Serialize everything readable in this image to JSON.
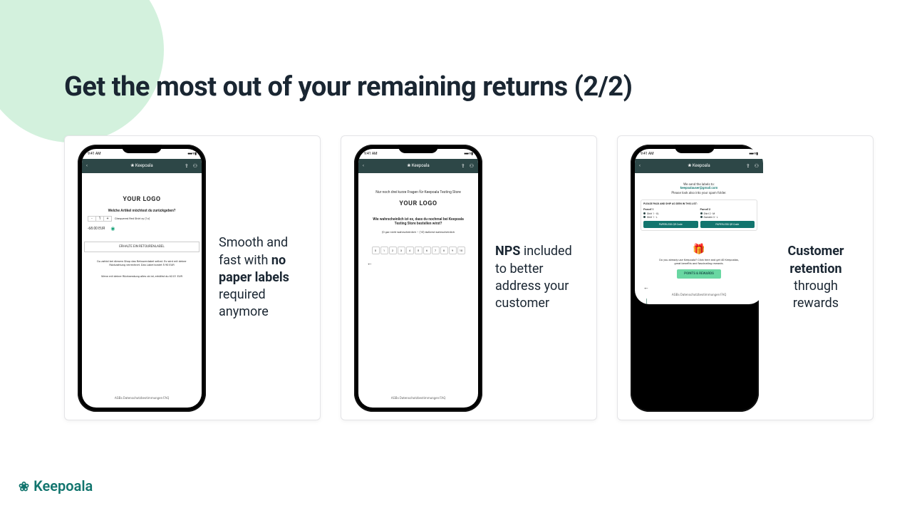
{
  "title": "Get the most out of your remaining returns (2/2)",
  "brand": "Keepoala",
  "statusbar": {
    "time": "9:41 AM",
    "signal": "●●● ᯤ ▮"
  },
  "appbar": {
    "title": "Keepoala"
  },
  "footer_links": "AGBs   Datenschutzbestimmungen   FAQ",
  "card1": {
    "caption_pre": "Smooth and fast with ",
    "caption_bold": "no paper labels",
    "caption_post": " required anymore",
    "logo": "YOUR LOGO",
    "question": "Welche Artikel möchtest du zurückgeben?",
    "item": "Chequered Red Shirt xy (1x)",
    "price": "-68.00 EUR",
    "btn": "ERHALTE EIN RETOURENLABEL",
    "note1": "Du zahlst bei diesem Shop das Retourenlabel selbst. Es wird mit deiner Rückzahlung verrechnet. Das Label kostet 5.90 EUR",
    "note2": "Wenn mit deiner Rücksendung alles ok ist, erhältst du 62.01 EUR"
  },
  "card2": {
    "caption_bold": "NPS",
    "caption_post": " included to better address your customer",
    "intro": "Nur noch drei kurze Fragen für Keepoala Testing Store",
    "logo": "YOUR LOGO",
    "q": "Wie wahrscheinlich ist es, dass du nochmal bei Keepoala Testing Store bestellen wirst?",
    "sub": "(0 gar nicht wahrscheinlich – (10) äußerst wahrscheinlich",
    "scale": [
      "0",
      "1",
      "2",
      "3",
      "4",
      "5",
      "6",
      "7",
      "8",
      "9",
      "10"
    ]
  },
  "card3": {
    "caption_bold": "Customer retention",
    "caption_post": " through rewards",
    "l1": "We send the labels to:",
    "email": "keepoalauser@gmail.com",
    "l2": "Please look also into your spam folder.",
    "boxhdr": "PLEASE PACK AND SHIP AS SEEN IN THIS LIST:",
    "p1": {
      "name": "Parcel 1",
      "i1": "Shirt 1 - XL",
      "i2": "Shirt 1 - L",
      "btn": "PAPERLESS QR Code"
    },
    "p2": {
      "name": "Parcel 2",
      "i1": "Shirt 2 - M",
      "i2": "Sweater 3 - L",
      "btn": "PAPERLESS QR Code"
    },
    "gift": "🎁",
    "promo": "Do you already use Keepoala? Click here and get 40 Keepoalas, great benefits and fascinating rewards.",
    "rewards": "POINTS & REWARDS"
  }
}
